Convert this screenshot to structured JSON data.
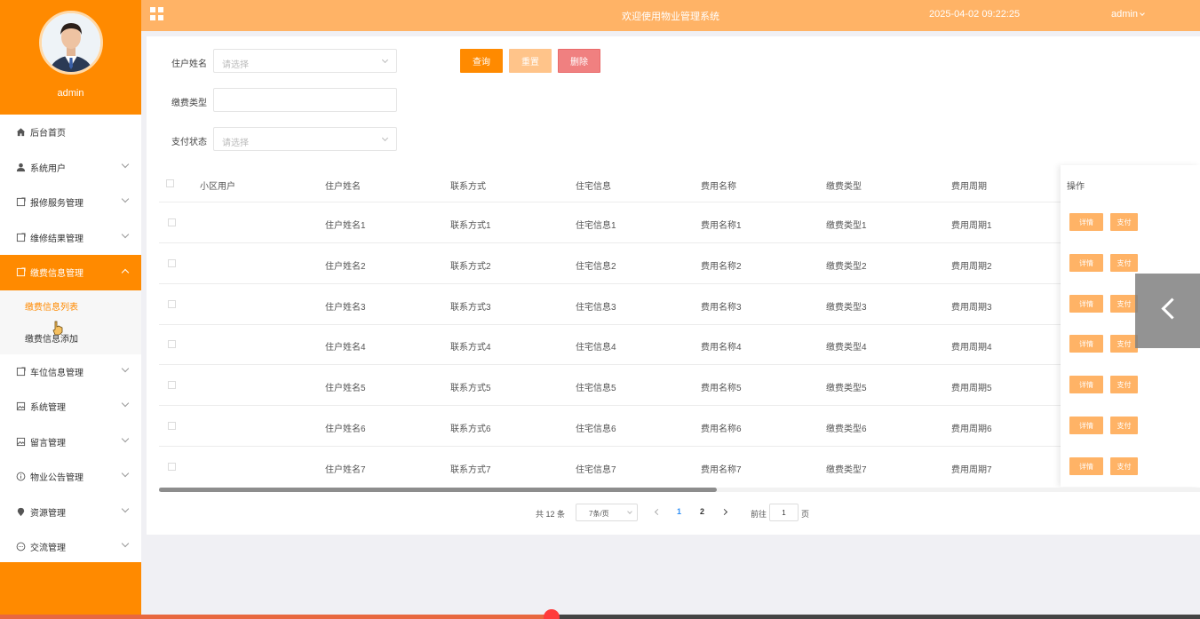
{
  "topbar": {
    "title": "欢迎使用物业管理系统",
    "datetime": "2025-04-02 09:22:25",
    "user": "admin"
  },
  "sidebar": {
    "username": "admin",
    "items": [
      {
        "label": "后台首页",
        "icon": "home-icon",
        "has_chevron": false
      },
      {
        "label": "系统用户",
        "icon": "user-icon",
        "has_chevron": true
      },
      {
        "label": "报修服务管理",
        "icon": "document-icon",
        "has_chevron": true
      },
      {
        "label": "维修结果管理",
        "icon": "document-icon",
        "has_chevron": true
      },
      {
        "label": "缴费信息管理",
        "icon": "document-icon",
        "has_chevron": true,
        "active": true
      },
      {
        "label": "车位信息管理",
        "icon": "document-icon",
        "has_chevron": true
      },
      {
        "label": "系统管理",
        "icon": "image-icon",
        "has_chevron": true
      },
      {
        "label": "留言管理",
        "icon": "image-icon",
        "has_chevron": true
      },
      {
        "label": "物业公告管理",
        "icon": "info-icon",
        "has_chevron": true
      },
      {
        "label": "资源管理",
        "icon": "location-icon",
        "has_chevron": true
      },
      {
        "label": "交流管理",
        "icon": "chat-icon",
        "has_chevron": true
      }
    ],
    "subitems": [
      {
        "label": "缴费信息列表",
        "current": true
      },
      {
        "label": "缴费信息添加",
        "current": false
      }
    ]
  },
  "filters": {
    "name_label": "住户姓名",
    "name_placeholder": "请选择",
    "type_label": "缴费类型",
    "type_value": "",
    "status_label": "支付状态",
    "status_placeholder": "请选择"
  },
  "buttons": {
    "query": "查询",
    "reset": "重置",
    "delete": "删除"
  },
  "table": {
    "headers": [
      "小区用户",
      "住户姓名",
      "联系方式",
      "住宅信息",
      "费用名称",
      "缴费类型",
      "费用周期",
      "操作"
    ],
    "rows": [
      [
        "",
        "住户姓名1",
        "联系方式1",
        "住宅信息1",
        "费用名称1",
        "缴费类型1",
        "费用周期1"
      ],
      [
        "",
        "住户姓名2",
        "联系方式2",
        "住宅信息2",
        "费用名称2",
        "缴费类型2",
        "费用周期2"
      ],
      [
        "",
        "住户姓名3",
        "联系方式3",
        "住宅信息3",
        "费用名称3",
        "缴费类型3",
        "费用周期3"
      ],
      [
        "",
        "住户姓名4",
        "联系方式4",
        "住宅信息4",
        "费用名称4",
        "缴费类型4",
        "费用周期4"
      ],
      [
        "",
        "住户姓名5",
        "联系方式5",
        "住宅信息5",
        "费用名称5",
        "缴费类型5",
        "费用周期5"
      ],
      [
        "",
        "住户姓名6",
        "联系方式6",
        "住宅信息6",
        "费用名称6",
        "缴费类型6",
        "费用周期6"
      ],
      [
        "",
        "住户姓名7",
        "联系方式7",
        "住宅信息7",
        "费用名称7",
        "缴费类型7",
        "费用周期7"
      ]
    ],
    "row_actions": {
      "detail": "详情",
      "pay": "支付"
    }
  },
  "pagination": {
    "total": "共 12 条",
    "page_size": "7条/页",
    "pages": [
      "1",
      "2"
    ],
    "current_page": "1",
    "goto_label": "前往",
    "goto_value": "1",
    "page_unit": "页"
  },
  "colors": {
    "primary": "#ff8a00",
    "topbar": "#ffb366",
    "danger": "#f08080"
  },
  "media_progress": 0.46
}
